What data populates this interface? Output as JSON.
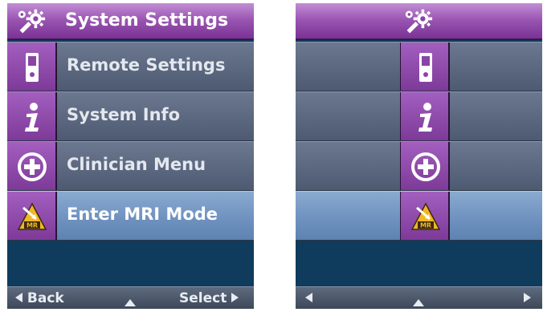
{
  "left_screen": {
    "header": {
      "title": "System Settings",
      "icon": "settings-gear-icon"
    },
    "menu_items": [
      {
        "label": "Remote Settings",
        "icon": "remote-control-icon",
        "selected": false
      },
      {
        "label": "System Info",
        "icon": "info-icon",
        "selected": false
      },
      {
        "label": "Clinician Menu",
        "icon": "plus-circle-icon",
        "selected": false
      },
      {
        "label": "Enter MRI Mode",
        "icon": "mri-warning-icon",
        "selected": true
      }
    ],
    "footer": {
      "back_label": "Back",
      "select_label": "Select"
    }
  },
  "right_screen": {
    "header": {
      "icon": "settings-gear-icon"
    },
    "menu_items": [
      {
        "icon": "remote-control-icon",
        "selected": false
      },
      {
        "icon": "info-icon",
        "selected": false
      },
      {
        "icon": "plus-circle-icon",
        "selected": false
      },
      {
        "icon": "mri-warning-icon",
        "selected": true
      }
    ]
  },
  "colors": {
    "header_purple": "#9b57b3",
    "icon_cell_purple": "#8d48aa",
    "row_gray": "#5c6980",
    "selected_row_blue": "#7396c2",
    "background_navy": "#0f3b5c",
    "mri_badge_yellow": "#f2b720"
  }
}
